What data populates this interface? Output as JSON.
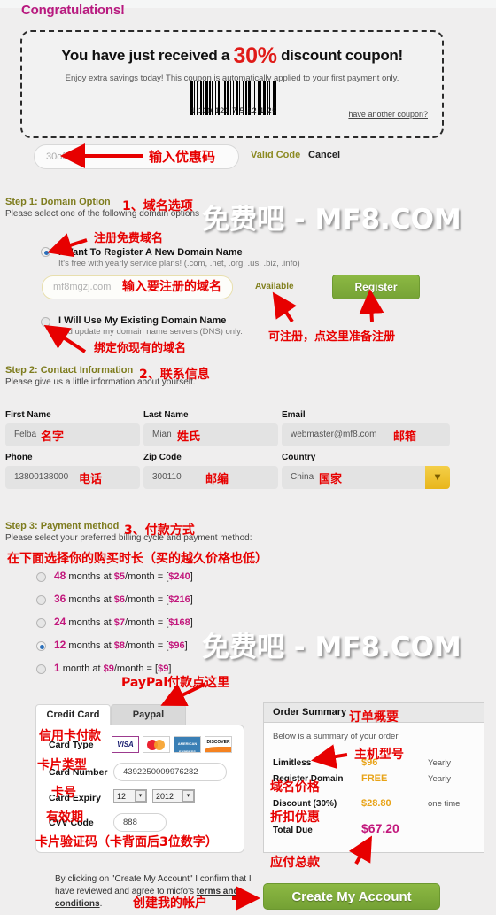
{
  "page_title": "Congratulations!",
  "coupon": {
    "headline_pre": "You have just received a ",
    "headline_pct": "30%",
    "headline_post": " discount coupon!",
    "subtext": "Enjoy extra savings today! This coupon is automatically applied to your first payment only.",
    "barcode_digits": "1  110 121 7 5 12 1 25",
    "another_coupon_link": "have another coupon?",
    "code_value": "30off",
    "valid_label": "Valid Code",
    "cancel_label": "Cancel"
  },
  "step1": {
    "title": "Step 1: Domain Option",
    "desc": "Please select one of the following domain options",
    "option_new_label": "I Want To Register A New Domain Name",
    "option_new_sub": "It's free with yearly service plans! (.com, .net, .org, .us, .biz, .info)",
    "option_existing_label": "I Will Use My Existing Domain Name",
    "option_existing_sub": "and update my domain name servers (DNS) only.",
    "domain_value": "mf8mgzj.com",
    "availability": "Available",
    "register_button": "Register"
  },
  "step2": {
    "title": "Step 2: Contact Information",
    "desc": "Please give us a little information about yourself.",
    "fields": [
      {
        "label": "First Name",
        "value": "Felba"
      },
      {
        "label": "Last Name",
        "value": "Mian"
      },
      {
        "label": "Email",
        "value": "webmaster@mf8.com"
      },
      {
        "label": "Phone",
        "value": "13800138000"
      },
      {
        "label": "Zip Code",
        "value": "300110"
      },
      {
        "label": "Country",
        "value": "China"
      }
    ]
  },
  "step3": {
    "title": "Step 3: Payment method",
    "desc": "Please select your preferred billing cycle and payment method:",
    "plans": [
      {
        "months": "48",
        "unit": "months",
        "rate": "$5",
        "total": "$240",
        "selected": false
      },
      {
        "months": "36",
        "unit": "months",
        "rate": "$6",
        "total": "$216",
        "selected": false
      },
      {
        "months": "24",
        "unit": "months",
        "rate": "$7",
        "total": "$168",
        "selected": false
      },
      {
        "months": "12",
        "unit": "months",
        "rate": "$8",
        "total": "$96",
        "selected": true
      },
      {
        "months": "1",
        "unit": "month",
        "rate": "$9",
        "total": "$9",
        "selected": false
      }
    ]
  },
  "payment": {
    "tab_credit": "Credit Card",
    "tab_paypal": "Paypal",
    "label_card_type": "Card Type",
    "label_card_number": "Card Number",
    "label_card_expiry": "Card Expiry",
    "label_cvv": "CVV Code",
    "card_number": "4392250009976282",
    "expiry_month": "12",
    "expiry_year": "2012",
    "cvv": "888",
    "logos": [
      "VISA",
      "MasterCard",
      "AMERICAN EXPRESS",
      "DISCOVER"
    ]
  },
  "order": {
    "heading": "Order Summary",
    "subtext": "Below is a summary of your order",
    "rows": [
      {
        "name": "Limitless",
        "amount": "$96",
        "period": "Yearly"
      },
      {
        "name": "Register Domain",
        "amount": "FREE",
        "period": "Yearly"
      },
      {
        "name": "Discount (30%)",
        "amount": "$28.80",
        "period": "one time"
      }
    ],
    "total_label": "Total Due",
    "total_amount": "$67.20"
  },
  "footer": {
    "terms_pre": "By clicking on \"Create My Account\" I confirm that I have reviewed and agree to micfo's ",
    "terms_link": "terms and conditions",
    "terms_post": ".",
    "create_button": "Create My Account"
  },
  "watermark": "免费吧 - MF8.COM",
  "annotations": {
    "coupon_code": "输入优惠码",
    "step1": "1、域名选项",
    "register_free_domain": "注册免费域名",
    "enter_domain": "输入要注册的域名",
    "bind_existing": "绑定你现有的域名",
    "available_note": "可注册，点这里准备注册",
    "step2": "2、联系信息",
    "first_name": "名字",
    "last_name": "姓氏",
    "email": "邮箱",
    "phone": "电话",
    "zip": "邮编",
    "country": "国家",
    "step3": "3、付款方式",
    "choose_term": "在下面选择你的购买时长（买的越久价格也低）",
    "paypal_note": "PayPal付款点这里",
    "credit_card": "信用卡付款",
    "card_type": "卡片类型",
    "card_number": "卡号",
    "card_expiry": "有效期",
    "cvv": "卡片验证码（卡背面后3位数字）",
    "order_summary": "订单概要",
    "host_model": "主机型号",
    "domain_price": "域名价格",
    "discount": "折扣优惠",
    "total_due": "应付总款",
    "create_account": "创建我的帐户"
  }
}
